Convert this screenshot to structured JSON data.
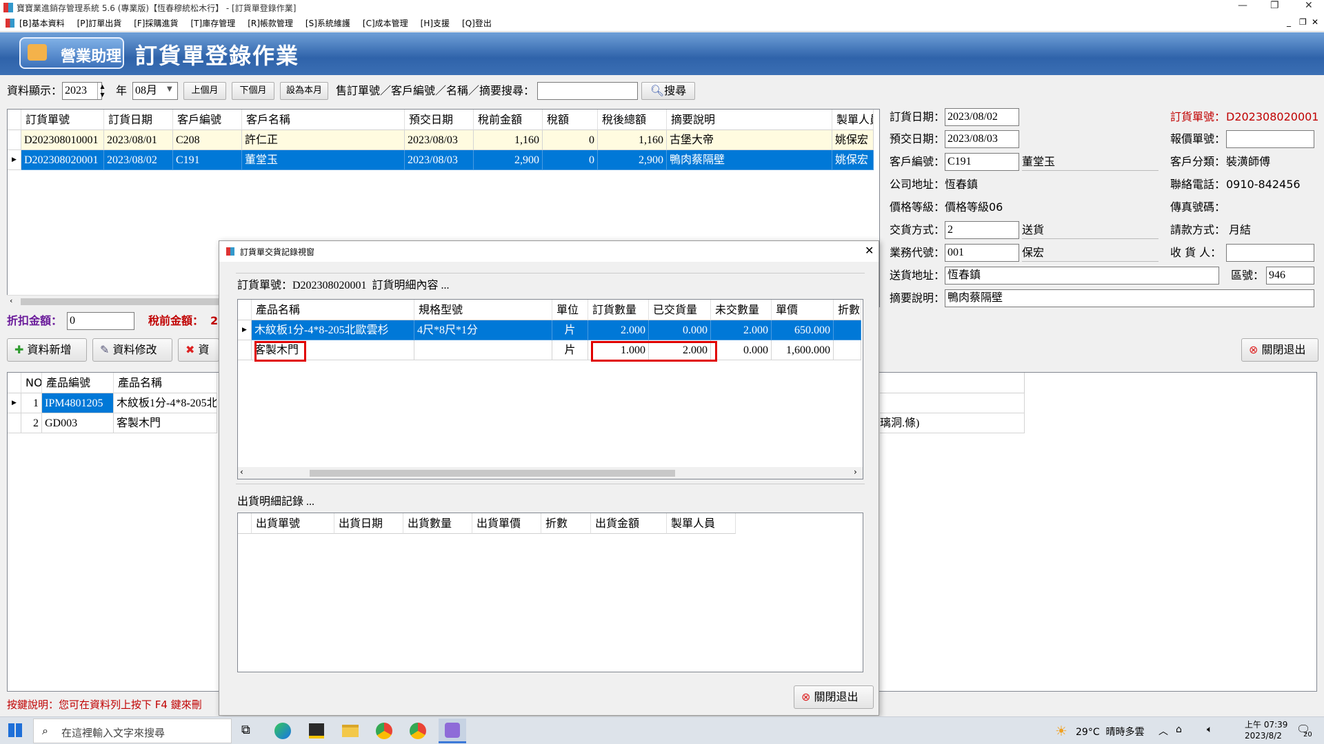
{
  "window": {
    "title": "寶寶業進銷存管理系統 5.6 (專業版)【恆春穆統松木行】 - [訂貨單登錄作業]",
    "controls": [
      "—",
      "❐",
      "✕"
    ]
  },
  "menu": [
    "[B]基本資料",
    "[P]訂單出貨",
    "[F]採購進貨",
    "[T]庫存管理",
    "[R]帳款管理",
    "[S]系統維護",
    "[C]成本管理",
    "[H]支援",
    "[Q]登出"
  ],
  "banner": {
    "badge": "營業助理",
    "title": "訂貨單登錄作業"
  },
  "toolbar": {
    "data_label": "資料顯示：",
    "year": "2023",
    "year_label": "年",
    "month": "08月",
    "prev_month": "上個月",
    "next_month": "下個月",
    "this_month": "設為本月",
    "search_label": "售訂單號／客戶編號／名稱／摘要搜尋：",
    "search_value": "",
    "search_button": "搜尋"
  },
  "orders": {
    "columns": [
      "訂貨單號",
      "訂貨日期",
      "客戶編號",
      "客戶名稱",
      "預交日期",
      "稅前金額",
      "稅額",
      "稅後總額",
      "摘要說明",
      "製單人員"
    ],
    "rows": [
      [
        "D202308010001",
        "2023/08/01",
        "C208",
        "許仁正",
        "2023/08/03",
        "1,160",
        "0",
        "1,160",
        "古堡大帝",
        "姚保宏"
      ],
      [
        "D202308020001",
        "2023/08/02",
        "C191",
        "董堂玉",
        "2023/08/03",
        "2,900",
        "0",
        "2,900",
        "鴨肉蔡隔壁",
        "姚保宏"
      ]
    ]
  },
  "summary": {
    "discount_label": "折扣金額：",
    "discount_value": "0",
    "pretax_label": "稅前金額：",
    "pretax_partial": "2"
  },
  "actions": {
    "add": "資料新增",
    "edit": "資料修改",
    "delete_partial": "資",
    "close": "關閉退出"
  },
  "details": {
    "columns": [
      "NO",
      "產品編號",
      "產品名稱"
    ],
    "rows": [
      [
        "1",
        "IPM4801205",
        "木紋板1分-4*8-205北"
      ],
      [
        "2",
        "GD003",
        "客製木門"
      ]
    ],
    "right_fragment": "璃洞.條)"
  },
  "form": {
    "order_date_label": "訂貨日期：",
    "order_date": "2023/08/02",
    "order_no_label": "訂貨單號：",
    "order_no": "D202308020001",
    "due_date_label": "預交日期：",
    "due_date": "2023/08/03",
    "quote_no_label": "報價單號：",
    "quote_no": "",
    "customer_id_label": "客戶編號：",
    "customer_id": "C191",
    "customer_name": "董堂玉",
    "customer_class_label": "客戶分類：",
    "customer_class": "裝潢師傅",
    "company_addr_label": "公司地址：",
    "company_addr": "恆春鎮",
    "phone_label": "聯絡電話：",
    "phone": "0910-842456",
    "price_level_label": "價格等級：",
    "price_level": "價格等級06",
    "fax_label": "傳真號碼：",
    "fax": "",
    "delivery_label": "交貨方式：",
    "delivery_code": "2",
    "delivery_name": "送貨",
    "payment_label": "請款方式：",
    "payment": "月結",
    "sales_label": "業務代號：",
    "sales_code": "001",
    "sales_name": "保宏",
    "receiver_label": "收 貨 人：",
    "receiver": "",
    "ship_addr_label": "送貨地址：",
    "ship_addr": "恆春鎮",
    "area_label": "區號：",
    "area": "946",
    "memo_label": "摘要說明：",
    "memo": "鴨肉蔡隔壁"
  },
  "status": "按鍵說明：您可在資料列上按下 F4 鍵來刪",
  "dialog": {
    "title": "訂貨單交貨記錄視窗",
    "header_text": "訂貨單號：D202308020001  訂貨明細內容 ...",
    "items": {
      "columns": [
        "產品名稱",
        "規格型號",
        "單位",
        "訂貨數量",
        "已交貨量",
        "未交數量",
        "單價",
        "折數"
      ],
      "rows": [
        [
          "木紋板1分-4*8-205北歐雲杉",
          "4尺*8尺*1分",
          "片",
          "2.000",
          "0.000",
          "2.000",
          "650.000",
          ""
        ],
        [
          "客製木門",
          "",
          "片",
          "1.000",
          "2.000",
          "0.000",
          "1,600.000",
          ""
        ]
      ]
    },
    "shipments_label": "出貨明細記錄 ...",
    "shipments": {
      "columns": [
        "出貨單號",
        "出貨日期",
        "出貨數量",
        "出貨單價",
        "折數",
        "出貨金額",
        "製單人員"
      ],
      "rows": []
    },
    "close_button": "關閉退出"
  },
  "taskbar": {
    "search_placeholder": "在這裡輸入文字來搜尋",
    "weather": "29°C  晴時多雲",
    "time": "上午 07:39",
    "date": "2023/8/2",
    "notif": "20"
  },
  "colors": {
    "accent": "#0078d7",
    "highlight_red": "#e00000",
    "banner": "#1f4e8c"
  }
}
